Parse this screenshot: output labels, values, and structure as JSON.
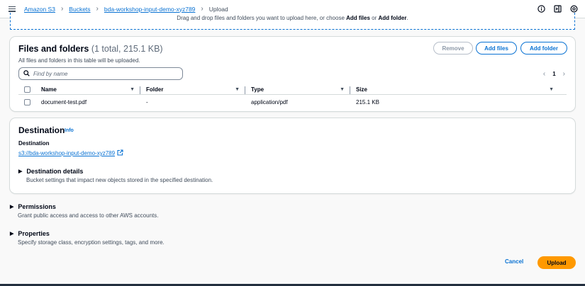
{
  "breadcrumb": {
    "items": [
      "Amazon S3",
      "Buckets",
      "bda-workshop-input-demo-xyz789",
      "Upload"
    ]
  },
  "dropzone": {
    "text_before": "Drag and drop files and folders you want to upload here, or choose ",
    "add_files": "Add files",
    "or": " or ",
    "add_folder": "Add folder",
    "period": "."
  },
  "files": {
    "title": "Files and folders",
    "count": "(1 total, 215.1 KB)",
    "description": "All files and folders in this table will be uploaded.",
    "remove_label": "Remove",
    "add_files_label": "Add files",
    "add_folder_label": "Add folder",
    "search_placeholder": "Find by name",
    "page": "1",
    "columns": [
      "Name",
      "Folder",
      "Type",
      "Size"
    ],
    "rows": [
      {
        "name": "document-test.pdf",
        "folder": "-",
        "type": "application/pdf",
        "size": "215.1 KB"
      }
    ]
  },
  "destination": {
    "title": "Destination",
    "info": "Info",
    "label": "Destination",
    "link": "s3://bda-workshop-input-demo-xyz789",
    "details_title": "Destination details",
    "details_desc": "Bucket settings that impact new objects stored in the specified destination."
  },
  "permissions": {
    "title": "Permissions",
    "desc": "Grant public access and access to other AWS accounts."
  },
  "properties": {
    "title": "Properties",
    "desc": "Specify storage class, encryption settings, tags, and more."
  },
  "footer": {
    "cancel_label": "Cancel",
    "upload_label": "Upload"
  },
  "colors": {
    "link": "#0972d3",
    "primary_button": "#ff9900",
    "border": "#d5dbdb"
  }
}
